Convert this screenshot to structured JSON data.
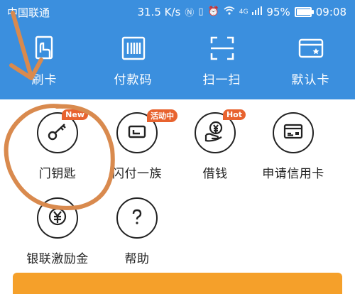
{
  "status_bar": {
    "carrier": "中国联通",
    "speed": "31.5 K/s",
    "network": "4G",
    "battery": "95%",
    "time": "09:08"
  },
  "toolbar": {
    "items": [
      {
        "label": "刷卡",
        "icon": "card-swipe-icon"
      },
      {
        "label": "付款码",
        "icon": "barcode-icon"
      },
      {
        "label": "扫一扫",
        "icon": "scan-icon"
      },
      {
        "label": "默认卡",
        "icon": "default-card-icon"
      }
    ]
  },
  "services": {
    "row1": [
      {
        "label": "门钥匙",
        "badge": "New",
        "icon": "key-icon"
      },
      {
        "label": "闪付一族",
        "badge": "活动中",
        "icon": "quickpass-icon"
      },
      {
        "label": "借钱",
        "badge": "Hot",
        "icon": "loan-icon"
      },
      {
        "label": "申请信用卡",
        "badge": "",
        "icon": "credit-card-icon"
      }
    ],
    "row2": [
      {
        "label": "银联激励金",
        "icon": "reward-yuan-icon"
      },
      {
        "label": "帮助",
        "icon": "help-icon"
      }
    ]
  },
  "colors": {
    "header_blue": "#3b8fde",
    "badge_orange": "#e8632f",
    "annotation_orange": "#d98a4e",
    "banner_orange": "#f5a02a"
  }
}
